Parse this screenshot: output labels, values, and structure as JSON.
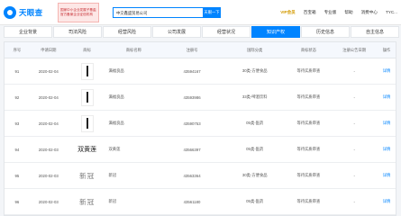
{
  "header": {
    "logo_text": "天眼查",
    "banner_lines": [
      "国家中小企业发展子基金旗下",
      "官方备案企业征信机构"
    ],
    "search_value": "中交鑫盛贸易公司",
    "search_button": "天眼一下",
    "nav": {
      "vip": "VIP会员",
      "enterprise": "百宝箱",
      "pro": "专业版",
      "help": "帮助",
      "contact": "消费中心",
      "user": "TYC..."
    }
  },
  "tabs": [
    {
      "label": "企业背景"
    },
    {
      "label": "司法风险"
    },
    {
      "label": "经营风险"
    },
    {
      "label": "公司发展"
    },
    {
      "label": "经营状况"
    },
    {
      "label": "知识产权"
    },
    {
      "label": "历史信息"
    },
    {
      "label": "自主信息"
    }
  ],
  "table": {
    "headers": [
      "序号",
      "申请日期",
      "商标",
      "商标名称",
      "注册号",
      "国际分类",
      "商标状态",
      "注册公告日期",
      "操作"
    ],
    "rows": [
      {
        "no": "91",
        "date": "2020-02-04",
        "logo": "bar",
        "name": "满福良品",
        "reg": "43594167",
        "class": "30类-方便食品",
        "status": "等待实质审查",
        "pub": "-",
        "action": "详情"
      },
      {
        "no": "92",
        "date": "2020-02-04",
        "logo": "bar",
        "name": "满福良品",
        "reg": "43593986",
        "class": "33类-啤酒饮料",
        "status": "等待实质审查",
        "pub": "-",
        "action": "详情"
      },
      {
        "no": "93",
        "date": "2020-02-04",
        "logo": "bar",
        "name": "满福良品",
        "reg": "43590753",
        "class": "05类-医药",
        "status": "等待实质审查",
        "pub": "-",
        "action": "详情"
      },
      {
        "no": "94",
        "date": "2020-02-03",
        "logo": "calligraphy",
        "logo_text": "双黄莲",
        "name": "双黄莲",
        "reg": "43566397",
        "class": "05类-医药",
        "status": "等待实质审查",
        "pub": "-",
        "action": "详情"
      },
      {
        "no": "95",
        "date": "2020-02-03",
        "logo": "serif",
        "logo_text": "新冠",
        "name": "新冠",
        "reg": "43563364",
        "class": "30类-方便食品",
        "status": "等待实质审查",
        "pub": "-",
        "action": "详情"
      },
      {
        "no": "96",
        "date": "2020-02-03",
        "logo": "serif",
        "logo_text": "新冠",
        "name": "新冠",
        "reg": "43561180",
        "class": "05类-医药",
        "status": "等待实质审查",
        "pub": "-",
        "action": "详情"
      }
    ]
  },
  "colors": {
    "accent": "#0084ff",
    "vip": "#d39a00",
    "banner_red": "#c5272d"
  }
}
